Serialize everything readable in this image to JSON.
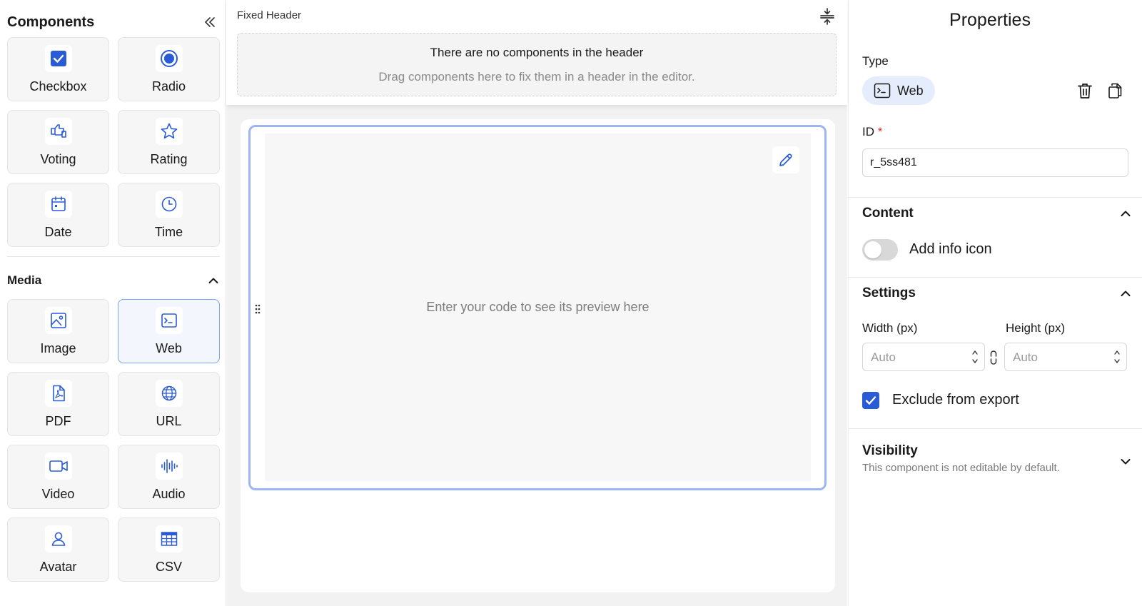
{
  "sidebar": {
    "title": "Components",
    "top_tiles": [
      {
        "label": "Checkbox",
        "icon": "checkbox-icon"
      },
      {
        "label": "Radio",
        "icon": "radio-icon"
      },
      {
        "label": "Voting",
        "icon": "voting-icon"
      },
      {
        "label": "Rating",
        "icon": "star-icon"
      },
      {
        "label": "Date",
        "icon": "calendar-icon"
      },
      {
        "label": "Time",
        "icon": "clock-icon"
      }
    ],
    "media": {
      "title": "Media",
      "tiles": [
        {
          "label": "Image",
          "icon": "image-icon"
        },
        {
          "label": "Web",
          "icon": "terminal-icon",
          "selected": true
        },
        {
          "label": "PDF",
          "icon": "pdf-icon"
        },
        {
          "label": "URL",
          "icon": "globe-icon"
        },
        {
          "label": "Video",
          "icon": "video-icon"
        },
        {
          "label": "Audio",
          "icon": "audio-wave-icon"
        },
        {
          "label": "Avatar",
          "icon": "user-icon"
        },
        {
          "label": "CSV",
          "icon": "table-icon"
        }
      ]
    }
  },
  "editor": {
    "fixed_header": {
      "label": "Fixed Header",
      "empty_title": "There are no components in the header",
      "empty_hint": "Drag components here to fix them in a header in the editor."
    },
    "web_block": {
      "placeholder": "Enter your code to see its preview here"
    }
  },
  "properties": {
    "title": "Properties",
    "type_label": "Type",
    "type_value": "Web",
    "id_label": "ID",
    "id_required": "*",
    "id_value": "r_5ss481",
    "content": {
      "title": "Content",
      "add_info_icon_label": "Add info icon",
      "add_info_icon_on": false
    },
    "settings": {
      "title": "Settings",
      "width_label": "Width (px)",
      "width_value": "Auto",
      "height_label": "Height (px)",
      "height_value": "Auto",
      "exclude_label": "Exclude from export",
      "exclude_checked": true
    },
    "visibility": {
      "title": "Visibility",
      "subtitle": "This component is not editable by default."
    }
  },
  "colors": {
    "accent": "#2a5bd7",
    "selected_border": "#7ea3f2",
    "chip_bg": "#e5ecfb"
  }
}
